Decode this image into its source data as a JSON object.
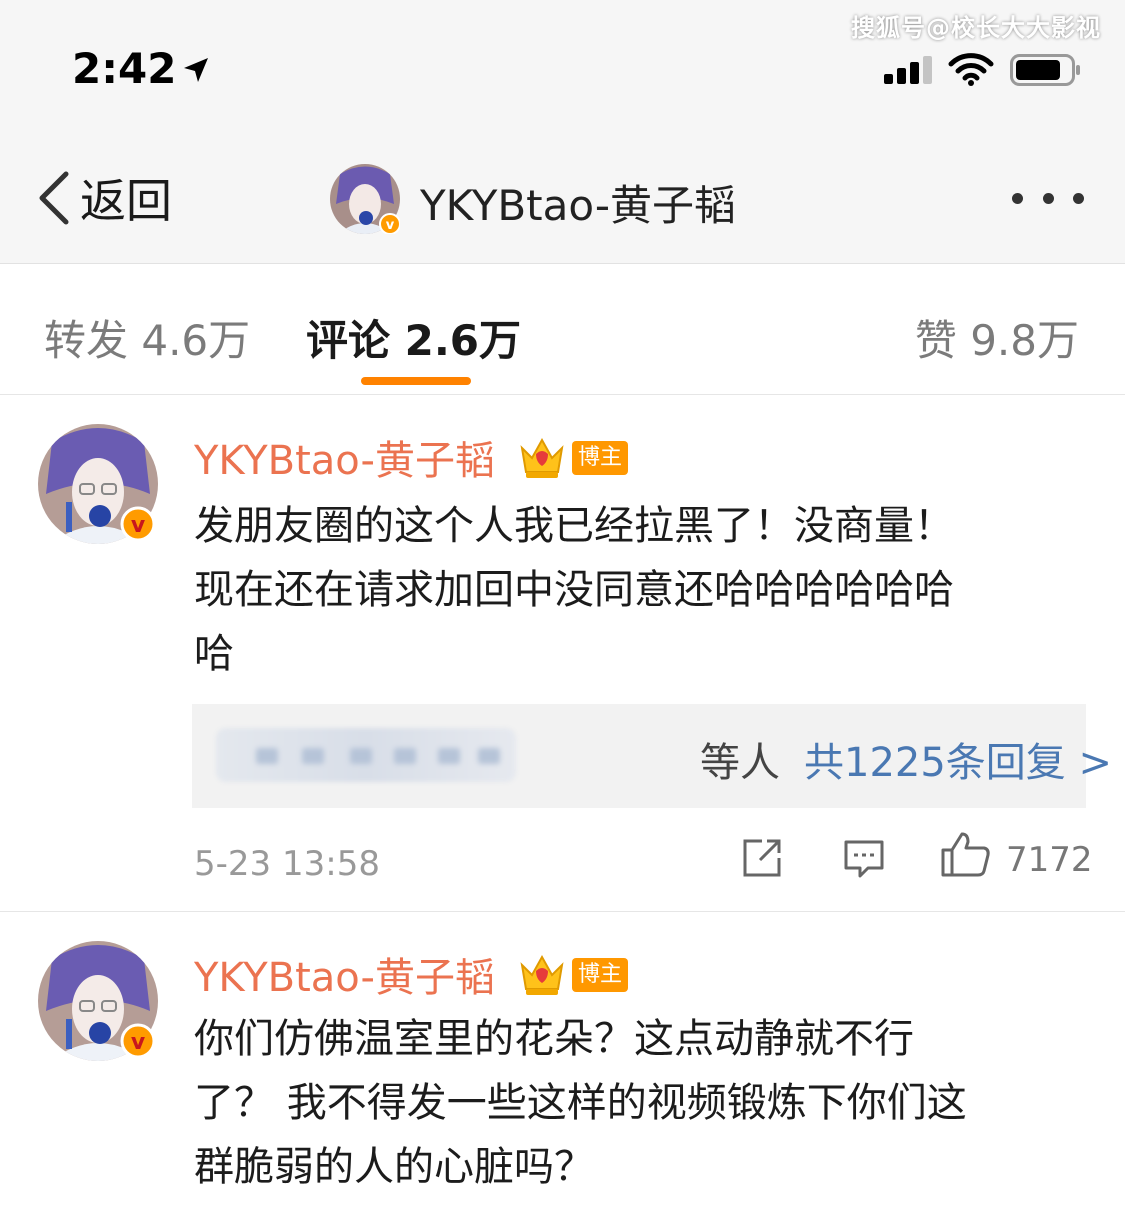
{
  "watermark": "搜狐号@校长大大影视",
  "status_bar": {
    "time": "2:42"
  },
  "nav": {
    "back_label": "返回",
    "title": "YKYBtao-黄子韬"
  },
  "tabs": [
    {
      "label": "转发 4.6万"
    },
    {
      "label": "评论 2.6万"
    },
    {
      "label": "赞 9.8万"
    }
  ],
  "comments": [
    {
      "username": "YKYBtao-黄子韬",
      "badge": "博主",
      "lines": [
        "发朋友圈的这个人我已经拉黑了！没商量！",
        "现在还在请求加回中没同意还哈哈哈哈哈哈",
        "哈"
      ],
      "replies": {
        "suffix": "等人",
        "count_text": "共1225条回复 >"
      },
      "time": "5-23 13:58",
      "likes": "7172"
    },
    {
      "username": "YKYBtao-黄子韬",
      "badge": "博主",
      "lines": [
        "你们仿佛温室里的花朵？这点动静就不行",
        "了？ 我不得发一些这样的视频锻炼下你们这",
        "群脆弱的人的心脏吗？"
      ]
    }
  ],
  "colors": {
    "accent": "#ff8200",
    "username": "#eb7350",
    "link": "#4a78b2",
    "badge": "#ff9800"
  }
}
